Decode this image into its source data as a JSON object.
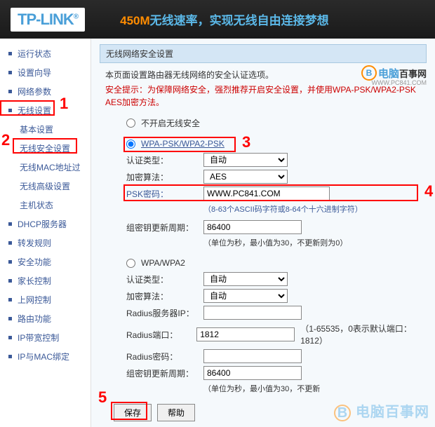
{
  "header": {
    "logo": "TP-LINK",
    "tagline_orange": "450M",
    "tagline_blue1": "无线速率，",
    "tagline_blue2": "实现无线自由连接梦想"
  },
  "sidebar": {
    "items": [
      {
        "label": "运行状态"
      },
      {
        "label": "设置向导"
      },
      {
        "label": "网络参数"
      },
      {
        "label": "无线设置"
      },
      {
        "label": "DHCP服务器"
      },
      {
        "label": "转发规则"
      },
      {
        "label": "安全功能"
      },
      {
        "label": "家长控制"
      },
      {
        "label": "上网控制"
      },
      {
        "label": "路由功能"
      },
      {
        "label": "IP带宽控制"
      },
      {
        "label": "IP与MAC绑定"
      }
    ],
    "subs": [
      {
        "label": "基本设置"
      },
      {
        "label": "无线安全设置"
      },
      {
        "label": "无线MAC地址过"
      },
      {
        "label": "无线高级设置"
      },
      {
        "label": "主机状态"
      }
    ]
  },
  "panel": {
    "title": "无线网络安全设置",
    "intro": "本页面设置路由器无线网络的安全认证选项。",
    "warning": "安全提示：为保障网络安全，强烈推荐开启安全设置，并使用WPA-PSK/WPA2-PSK AES加密方法。",
    "brand": {
      "text1": "电脑",
      "text2": "百事网",
      "url": "WWW.PC841.COM",
      "icon": "B"
    }
  },
  "options": {
    "disable": "不开启无线安全",
    "wpapsk": "WPA-PSK/WPA2-PSK",
    "wpa": "WPA/WPA2"
  },
  "wpapsk": {
    "auth_label": "认证类型：",
    "auth_value": "自动",
    "enc_label": "加密算法：",
    "enc_value": "AES",
    "psk_label": "PSK密码：",
    "psk_value": "WWW.PC841.COM",
    "psk_hint": "（8-63个ASCII码字符或8-64个十六进制字符）",
    "rekey_label": "组密钥更新周期：",
    "rekey_value": "86400",
    "rekey_hint": "（单位为秒，最小值为30，不更新则为0）"
  },
  "wpa": {
    "auth_label": "认证类型：",
    "auth_value": "自动",
    "enc_label": "加密算法：",
    "enc_value": "自动",
    "radius_ip_label": "Radius服务器IP：",
    "radius_ip_value": "",
    "radius_port_label": "Radius端口：",
    "radius_port_value": "1812",
    "radius_port_hint": "（1-65535，0表示默认端口：1812）",
    "radius_pwd_label": "Radius密码：",
    "radius_pwd_value": "",
    "rekey_label": "组密钥更新周期：",
    "rekey_value": "86400",
    "rekey_hint": "（单位为秒，最小值为30，不更新"
  },
  "buttons": {
    "save": "保存",
    "help": "帮助"
  },
  "markers": {
    "m1": "1",
    "m2": "2",
    "m3": "3",
    "m4": "4",
    "m5": "5"
  },
  "watermark": "电脑百事网"
}
